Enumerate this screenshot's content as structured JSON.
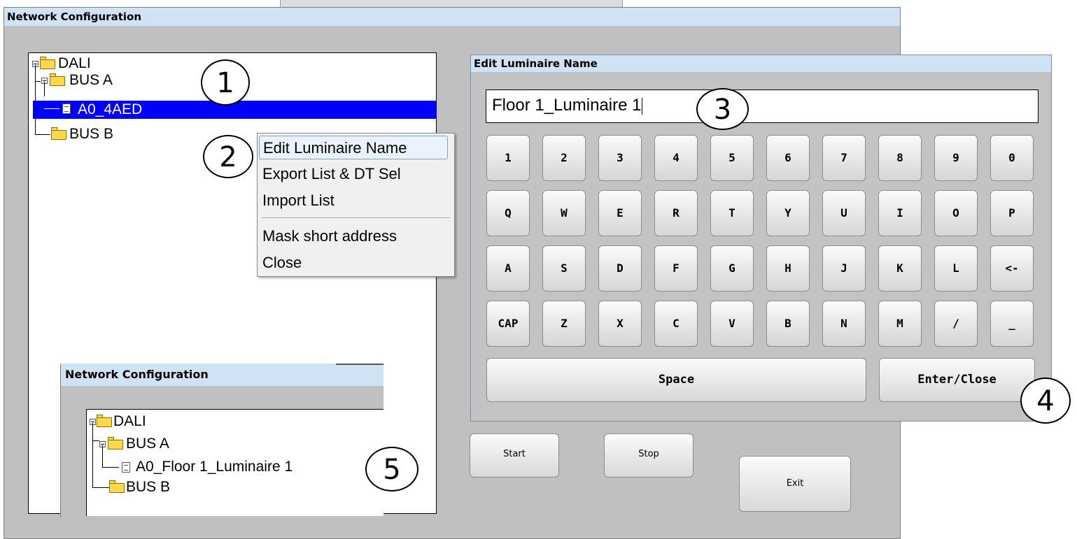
{
  "main_window": {
    "title": "Network Configuration"
  },
  "tree": {
    "root": "DALI",
    "bus_a": "BUS A",
    "luminaire": "A0_4AED",
    "bus_b": "BUS B"
  },
  "context_menu": {
    "items": [
      "Edit Luminaire Name",
      "Export List & DT Sel",
      "Import List",
      "Mask short address",
      "Close"
    ]
  },
  "edit_dialog": {
    "title": "Edit Luminaire Name",
    "input_value": "Floor 1_Luminaire 1",
    "keyboard": {
      "row1": [
        "1",
        "2",
        "3",
        "4",
        "5",
        "6",
        "7",
        "8",
        "9",
        "0"
      ],
      "row2": [
        "Q",
        "W",
        "E",
        "R",
        "T",
        "Y",
        "U",
        "I",
        "O",
        "P"
      ],
      "row3": [
        "A",
        "S",
        "D",
        "F",
        "G",
        "H",
        "J",
        "K",
        "L",
        "<-"
      ],
      "row4": [
        "CAP",
        "Z",
        "X",
        "C",
        "V",
        "B",
        "N",
        "M",
        "/",
        "_"
      ],
      "space": "Space",
      "enter": "Enter/Close"
    }
  },
  "buttons": {
    "start": "Start",
    "stop": "Stop",
    "exit": "Exit"
  },
  "mini_window": {
    "title": "Network Configuration",
    "root": "DALI",
    "bus_a": "BUS A",
    "luminaire": "A0_Floor 1_Luminaire 1",
    "bus_b": "BUS B"
  },
  "callouts": [
    "1",
    "2",
    "3",
    "4",
    "5"
  ],
  "colors": {
    "selection": "#0000ff",
    "titlebar": "#cfe3f5",
    "window_bg": "#c0c0c0"
  }
}
